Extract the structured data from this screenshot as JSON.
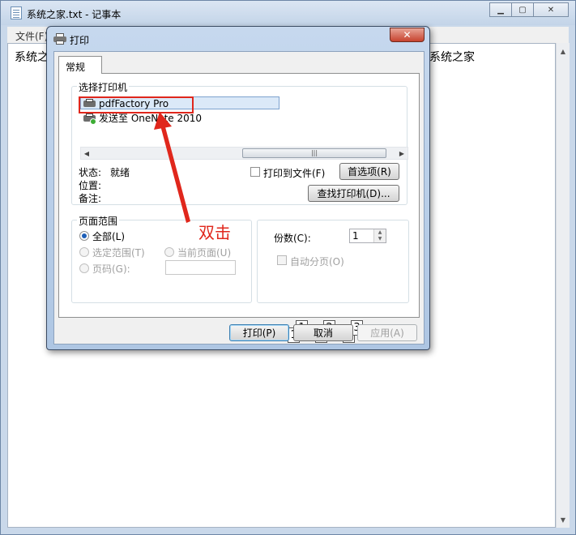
{
  "notepad": {
    "title": "系统之家.txt - 记事本",
    "menu_file": "文件(F)",
    "content_left": "系统之",
    "content_right": "系统之家",
    "controls": {
      "minimize": "▁",
      "maximize": "▢",
      "close": "✕"
    }
  },
  "dialog": {
    "title": "打印",
    "close": "✕",
    "tab": "常规",
    "select_printer": {
      "legend": "选择打印机",
      "printers": [
        {
          "name": "pdfFactory Pro",
          "selected": true
        },
        {
          "name": "发送至 OneNote 2010",
          "selected": false
        }
      ],
      "status_label": "状态:",
      "status_value": "就绪",
      "location_label": "位置:",
      "comment_label": "备注:",
      "print_to_file": "打印到文件(F)",
      "preferences": "首选项(R)",
      "find_printer": "查找打印机(D)..."
    },
    "page_range": {
      "legend": "页面范围",
      "all": "全部(L)",
      "selection": "选定范围(T)",
      "current_page": "当前页面(U)",
      "pages": "页码(G):"
    },
    "copies": {
      "label": "份数(C):",
      "value": "1",
      "collate": "自动分页(O)",
      "collate_pages": [
        "1",
        "1",
        "2",
        "2",
        "3",
        "3"
      ]
    },
    "buttons": {
      "print": "打印(P)",
      "cancel": "取消",
      "apply": "应用(A)"
    }
  },
  "annotation": {
    "text": "双击",
    "color": "#e0271c"
  }
}
